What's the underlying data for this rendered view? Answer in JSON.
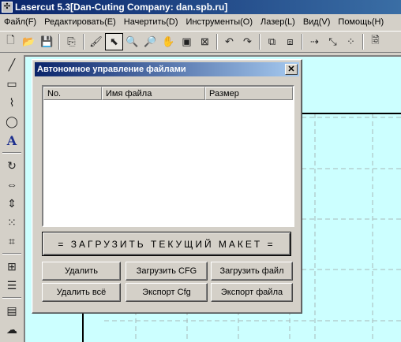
{
  "app": {
    "title": "Lasercut 5.3[Dan-Cuting Company: dan.spb.ru]",
    "icon": "lasercut-app-icon"
  },
  "menu": [
    {
      "label": "Файл(F)"
    },
    {
      "label": "Редактировать(E)"
    },
    {
      "label": "Начертить(D)"
    },
    {
      "label": "Инструменты(O)"
    },
    {
      "label": "Лазер(L)"
    },
    {
      "label": "Вид(V)"
    },
    {
      "label": "Помощь(H)"
    }
  ],
  "toolbar": {
    "buttons": [
      {
        "name": "new-file-icon",
        "glyph": "🗋"
      },
      {
        "name": "open-folder-icon",
        "glyph": "📂"
      },
      {
        "name": "save-icon",
        "glyph": "💾"
      },
      {
        "name": "import-icon",
        "glyph": "⎘"
      },
      {
        "name": "brush-icon",
        "glyph": "🖌"
      },
      {
        "name": "select-arrow-icon",
        "glyph": "⬉",
        "active": true
      },
      {
        "name": "zoom-in-icon",
        "glyph": "🔍"
      },
      {
        "name": "zoom-out-icon",
        "glyph": "🔎"
      },
      {
        "name": "pan-hand-icon",
        "glyph": "✋"
      },
      {
        "name": "zoom-window-icon",
        "glyph": "▣"
      },
      {
        "name": "zoom-fit-icon",
        "glyph": "⊠"
      },
      {
        "name": "undo-icon",
        "glyph": "↶"
      },
      {
        "name": "redo-icon",
        "glyph": "↷"
      },
      {
        "name": "group-icon",
        "glyph": "⧉"
      },
      {
        "name": "ungroup-icon",
        "glyph": "⧈"
      },
      {
        "name": "path-direction-icon",
        "glyph": "⇢"
      },
      {
        "name": "line-tool-icon",
        "glyph": "⤡"
      },
      {
        "name": "array-icon",
        "glyph": "⁘"
      },
      {
        "name": "preview-icon",
        "glyph": "🗟"
      },
      {
        "name": "extra-icon",
        "glyph": "⚙"
      }
    ]
  },
  "left_tools": [
    {
      "name": "line-tool-icon",
      "glyph": "╱"
    },
    {
      "name": "rectangle-tool-icon",
      "glyph": "▭"
    },
    {
      "name": "polyline-tool-icon",
      "glyph": "⌇"
    },
    {
      "name": "ellipse-tool-icon",
      "glyph": "◯"
    },
    {
      "name": "text-tool-icon",
      "glyph": "A"
    },
    {
      "name": "rotate-tool-icon",
      "glyph": "↻"
    },
    {
      "name": "mirror-horizontal-icon",
      "glyph": "⇔"
    },
    {
      "name": "mirror-vertical-icon",
      "glyph": "⇕"
    },
    {
      "name": "node-edit-icon",
      "glyph": "⁙"
    },
    {
      "name": "crop-icon",
      "glyph": "⌗"
    },
    {
      "name": "grid-icon",
      "glyph": "⊞"
    },
    {
      "name": "align-icon",
      "glyph": "☰"
    },
    {
      "name": "ruler-icon",
      "glyph": "▤"
    },
    {
      "name": "laser-tool-icon",
      "glyph": "☁"
    }
  ],
  "dialog": {
    "title": "Автономное управление файлами",
    "close_glyph": "✕",
    "columns": [
      "No.",
      "Имя файла",
      "Размер"
    ],
    "rows": [],
    "load_layout_label": "= ЗАГРУЗИТЬ  ТЕКУЩИЙ  МАКЕТ =",
    "buttons": {
      "delete": "Удалить",
      "load_cfg": "Загрузить CFG",
      "load_file": "Загрузить файл",
      "delete_all": "Удалить всё",
      "export_cfg": "Экспорт Cfg",
      "export_file": "Экспорт файла"
    }
  },
  "colors": {
    "canvas_bg": "#ccffff",
    "title_bar": "#0a246a",
    "window_face": "#d4d0c8"
  }
}
